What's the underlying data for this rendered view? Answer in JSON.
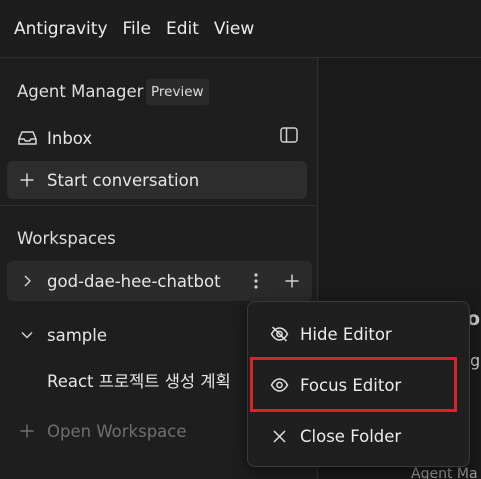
{
  "menubar": {
    "app_name": "Antigravity",
    "items": [
      "File",
      "Edit",
      "View"
    ]
  },
  "sidebar": {
    "agent_manager": {
      "title": "Agent Manager",
      "badge": "Preview"
    },
    "inbox": {
      "icon": "inbox-icon",
      "label": "Inbox",
      "toggle_icon": "sidebar-toggle-icon"
    },
    "start_conversation": {
      "icon": "plus-icon",
      "label": "Start conversation"
    },
    "workspaces": {
      "title": "Workspaces",
      "items": [
        {
          "name": "god-dae-hee-chatbot",
          "expanded": false
        },
        {
          "name": "sample",
          "expanded": true,
          "children": [
            "React 프로젝트 생성 계획"
          ]
        }
      ],
      "open_workspace": "Open Workspace"
    }
  },
  "context_menu": {
    "items": [
      {
        "icon": "eye-off-icon",
        "label": "Hide Editor"
      },
      {
        "icon": "eye-icon",
        "label": "Focus Editor",
        "highlighted": true
      },
      {
        "icon": "close-icon",
        "label": "Close Folder"
      }
    ]
  },
  "background_fragments": {
    "text_o": "o",
    "text_g": "g",
    "text_agent": "Agent Ma"
  },
  "colors": {
    "background": "#1c1c1c",
    "sidebar": "#1e1e1e",
    "selected_row": "#2b2b2b",
    "highlight_box": "#e0202a"
  }
}
